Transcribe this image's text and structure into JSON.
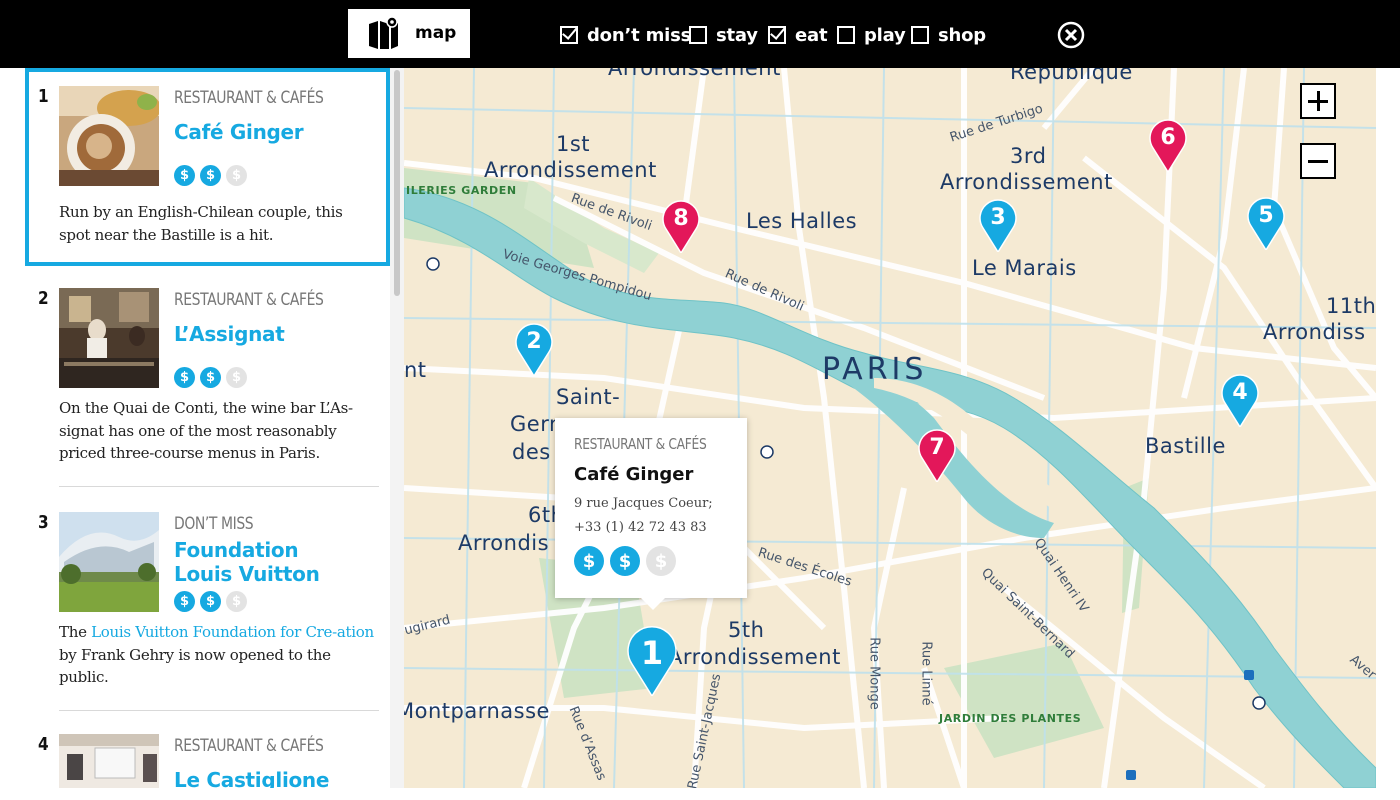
{
  "topbar": {
    "map_label": "map",
    "filters": [
      {
        "label": "don’t miss",
        "checked": true
      },
      {
        "label": "stay",
        "checked": false
      },
      {
        "label": "eat",
        "checked": true
      },
      {
        "label": "play",
        "checked": false
      },
      {
        "label": "shop",
        "checked": false
      }
    ]
  },
  "list": [
    {
      "num": "1",
      "category": "RESTAURANT & CAFÉS",
      "name": "Café Ginger",
      "price_level": 2,
      "price_max": 3,
      "desc": "Run by an English-Chilean couple, this spot near the Bastille is a hit."
    },
    {
      "num": "2",
      "category": "RESTAURANT & CAFÉS",
      "name": "L’Assignat",
      "price_level": 2,
      "price_max": 3,
      "desc": "On the Quai de Conti, the wine bar L’As-signat has one of the most reasonably priced three-course menus in Paris."
    },
    {
      "num": "3",
      "category": "DON’T MISS",
      "name_line1": "Foundation",
      "name_line2": "Louis Vuitton",
      "price_level": 2,
      "price_max": 3,
      "desc_pre": "The ",
      "desc_link": "Louis Vuitton Foundation for Cre-ation",
      "desc_post": " by Frank Gehry is now opened to the public."
    },
    {
      "num": "4",
      "category": "RESTAURANT & CAFÉS",
      "name": "Le Castiglione"
    }
  ],
  "map": {
    "labels": {
      "arr_top": "Arrondissement",
      "republique": "République",
      "first_a": "1st",
      "first_b": "Arrondissement",
      "third_a": "3rd",
      "third_b": "Arrondissement",
      "les_halles": "Les Halles",
      "le_marais": "Le Marais",
      "paris": "PARIS",
      "eleventh_a": "11th",
      "eleventh_b": "Arrondiss",
      "bastille": "Bastille",
      "saint_a": "Saint-",
      "saint_b": "Gern",
      "saint_c": "des",
      "sixth_a": "6th",
      "sixth_b": "Arrondis",
      "fifth_a": "5th",
      "fifth_b": "Arrondissement",
      "montparnasse": "Montparnasse",
      "nt": "nt",
      "tuileries": "ILERIES GARDEN",
      "jardin": "JARDIN DES PLANTES",
      "rue_rivoli_1": "Rue de Rivoli",
      "rue_rivoli_2": "Rue de Rivoli",
      "voie_georges": "Voie Georges Pompidou",
      "rue_turbigo": "Rue de Turbigo",
      "rue_ecoles": "Rue des Écoles",
      "quai_henri": "Quai Henri IV",
      "quai_bernard": "Quai Saint-Bernard",
      "rue_monge": "Rue Monge",
      "rue_linne": "Rue Linné",
      "rue_assas": "Rue d’Assas",
      "rue_jacques": "Rue Saint-Jacques",
      "vaugirard": "ugirard",
      "avenue": "Aver"
    },
    "pins": [
      {
        "num": "1",
        "color": "#16a9e1",
        "selected": true
      },
      {
        "num": "2",
        "color": "#16a9e1"
      },
      {
        "num": "3",
        "color": "#16a9e1"
      },
      {
        "num": "4",
        "color": "#16a9e1"
      },
      {
        "num": "5",
        "color": "#16a9e1"
      },
      {
        "num": "6",
        "color": "#e3175a"
      },
      {
        "num": "7",
        "color": "#e3175a"
      },
      {
        "num": "8",
        "color": "#e3175a"
      }
    ],
    "popup": {
      "category": "RESTAURANT & CAFÉS",
      "name": "Café Ginger",
      "address_line1": "9 rue Jacques Coeur;",
      "address_line2": "+33 (1) 42 72 43 83",
      "price_level": 2,
      "price_max": 3
    }
  },
  "colors": {
    "accent": "#16a9e1",
    "pin_red": "#e3175a",
    "river": "#8fd1d3",
    "land": "#f5ead3"
  }
}
